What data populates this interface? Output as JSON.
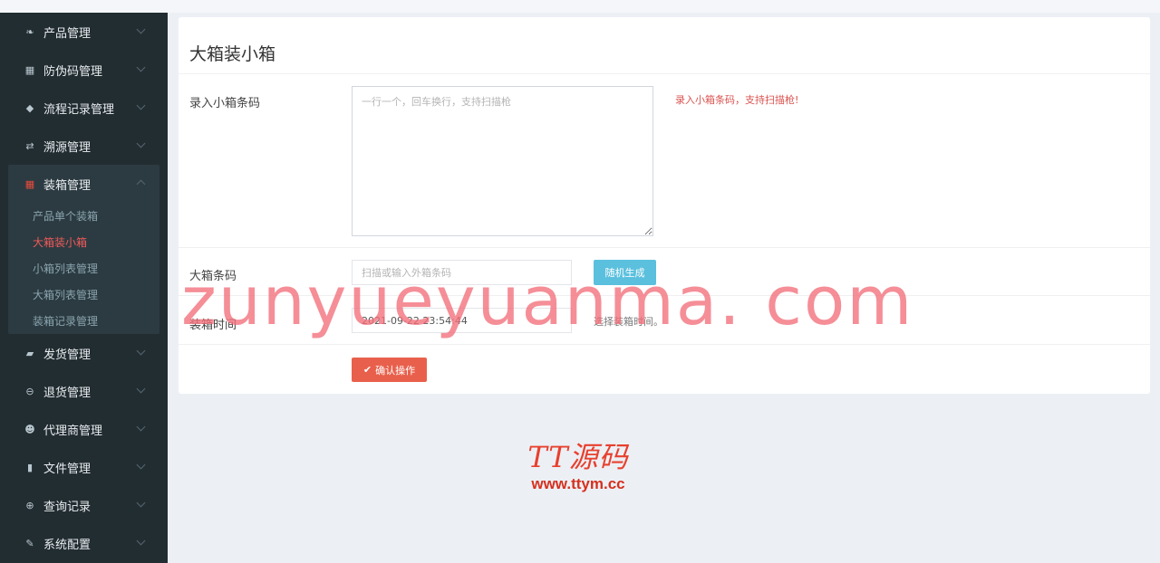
{
  "sidebar": {
    "items_top": [
      {
        "label": "产品管理",
        "icon": "leaf-icon"
      },
      {
        "label": "防伪码管理",
        "icon": "qrcode-icon"
      },
      {
        "label": "流程记录管理",
        "icon": "tags-icon"
      },
      {
        "label": "溯源管理",
        "icon": "retweet-icon"
      }
    ],
    "active_group": {
      "label": "装箱管理",
      "icon": "grid-icon",
      "sub_items": [
        "产品单个装箱",
        "大箱装小箱",
        "小箱列表管理",
        "大箱列表管理",
        "装箱记录管理"
      ],
      "active_sub": "大箱装小箱"
    },
    "items_bottom": [
      {
        "label": "发货管理",
        "icon": "truck-icon"
      },
      {
        "label": "退货管理",
        "icon": "minus-circle-icon"
      },
      {
        "label": "代理商管理",
        "icon": "users-icon"
      },
      {
        "label": "文件管理",
        "icon": "file-icon"
      },
      {
        "label": "查询记录",
        "icon": "search-icon"
      },
      {
        "label": "系统配置",
        "icon": "wrench-icon"
      }
    ]
  },
  "form": {
    "title": "大箱装小箱",
    "small_box_label": "录入小箱条码",
    "small_box_placeholder": "一行一个，回车换行，支持扫描枪",
    "small_box_hint": "录入小箱条码，支持扫描枪!",
    "big_box_label": "大箱条码",
    "big_box_placeholder": "扫描或输入外箱条码",
    "random_button": "随机生成",
    "time_label": "装箱时间",
    "time_value": "2021-09-22 23:54:44",
    "time_hint": "选择装箱时间。",
    "confirm_button": "确认操作"
  },
  "overlay": {
    "watermark": "zunyueyuanma. com",
    "logo_main": "TT源码",
    "logo_url": "www.ttym.cc"
  },
  "colors": {
    "sidebar_bg": "#222d32",
    "active_red": "#f05a5a",
    "info": "#5bc0de",
    "danger": "#e8604c"
  }
}
